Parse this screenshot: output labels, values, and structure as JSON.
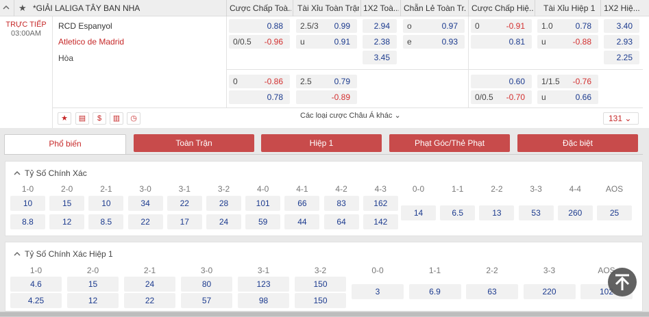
{
  "header": {
    "league": "*GIẢI LALIGA TÂY BAN NHA",
    "cols": [
      "Cược Chấp Toà...",
      "Tài Xỉu Toàn Trận",
      "1X2 Toà...",
      "Chẵn Lẻ Toàn Tr...",
      "Cược Chấp Hiệ...",
      "Tài Xỉu Hiệp 1",
      "1X2 Hiệ..."
    ]
  },
  "match": {
    "status": "TRỰC TIẾP",
    "time": "03:00AM",
    "home": "RCD Espanyol",
    "away": "Atletico de Madrid",
    "draw": "Hòa"
  },
  "odds": {
    "hcap_ft": [
      {
        "h": "",
        "v": "0.88"
      },
      {
        "h": "0/0.5",
        "v": "-0.96"
      }
    ],
    "ou_ft": [
      {
        "h": "2.5/3",
        "v": "0.99"
      },
      {
        "h": "u",
        "v": "0.91"
      }
    ],
    "x12_ft": [
      "2.94",
      "2.38",
      "3.45"
    ],
    "oe_ft": [
      {
        "h": "o",
        "v": "0.97"
      },
      {
        "h": "e",
        "v": "0.93"
      }
    ],
    "hcap_h1": [
      {
        "h": "0",
        "v": "-0.91"
      },
      {
        "h": "",
        "v": "0.81"
      }
    ],
    "ou_h1": [
      {
        "h": "1.0",
        "v": "0.78"
      },
      {
        "h": "u",
        "v": "-0.88"
      }
    ],
    "x12_h1": [
      "3.40",
      "2.93",
      "2.25"
    ],
    "alt_hcap_ft": [
      {
        "h": "0",
        "v": "-0.86"
      },
      {
        "h": "",
        "v": "0.78"
      }
    ],
    "alt_ou_ft": [
      {
        "h": "2.5",
        "v": "0.79"
      },
      {
        "h": "",
        "v": "-0.89"
      }
    ],
    "alt_hcap_h1": [
      {
        "h": "",
        "v": "0.60"
      },
      {
        "h": "0/0.5",
        "v": "-0.70"
      }
    ],
    "alt_ou_h1": [
      {
        "h": "1/1.5",
        "v": "-0.76"
      },
      {
        "h": "u",
        "v": "0.66"
      }
    ]
  },
  "toolbar": {
    "more_bets": "Các loại cược Châu Á khác",
    "market_count": "131"
  },
  "tabs": [
    "Phổ biến",
    "Toàn Trận",
    "Hiệp 1",
    "Phạt Góc/Thẻ Phạt",
    "Đặc biệt"
  ],
  "correct_score": {
    "title": "Tỷ Số Chính Xác",
    "scores": [
      "1-0",
      "2-0",
      "2-1",
      "3-0",
      "3-1",
      "3-2",
      "4-0",
      "4-1",
      "4-2",
      "4-3"
    ],
    "home": [
      "10",
      "15",
      "10",
      "34",
      "22",
      "28",
      "101",
      "66",
      "83",
      "162"
    ],
    "away": [
      "8.8",
      "12",
      "8.5",
      "22",
      "17",
      "24",
      "59",
      "44",
      "64",
      "142"
    ],
    "draw_scores": [
      "0-0",
      "1-1",
      "2-2",
      "3-3",
      "4-4",
      "AOS"
    ],
    "draw": [
      "14",
      "6.5",
      "13",
      "53",
      "260",
      "25"
    ]
  },
  "correct_score_h1": {
    "title": "Tỷ Số Chính Xác Hiệp 1",
    "scores": [
      "1-0",
      "2-0",
      "2-1",
      "3-0",
      "3-1",
      "3-2"
    ],
    "home": [
      "4.6",
      "15",
      "24",
      "80",
      "123",
      "150"
    ],
    "away": [
      "4.25",
      "12",
      "22",
      "57",
      "98",
      "150"
    ],
    "draw_scores": [
      "0-0",
      "1-1",
      "2-2",
      "3-3",
      "AOS"
    ],
    "draw": [
      "3",
      "6.9",
      "63",
      "220",
      "102"
    ]
  },
  "colors": {
    "accent": "#c84b4b",
    "odds": "#1b3a8e",
    "negative": "#d32f2f"
  }
}
